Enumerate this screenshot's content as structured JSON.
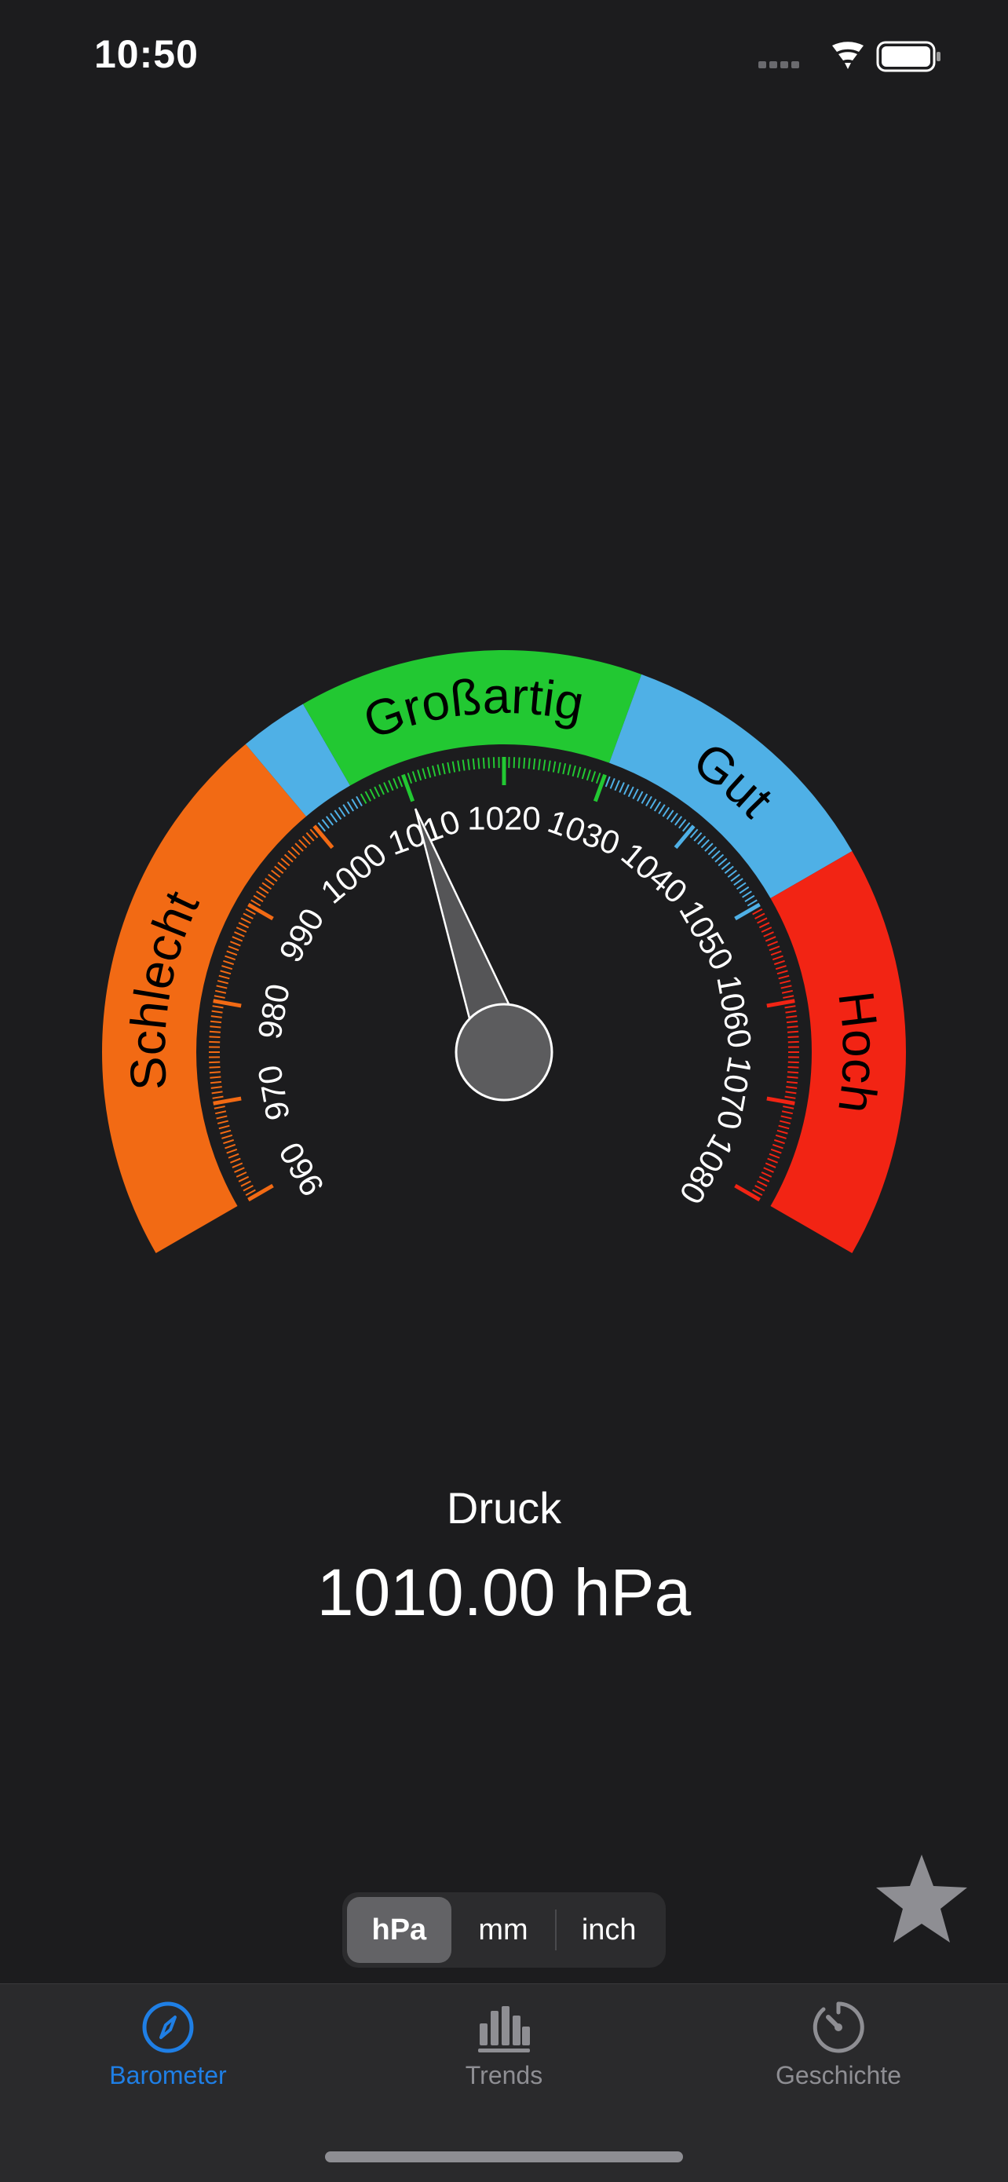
{
  "status": {
    "time": "10:50"
  },
  "gauge": {
    "unit": "hPa",
    "value": 1010,
    "min": 960,
    "max": 1080,
    "tick_labels": [
      "960",
      "970",
      "980",
      "990",
      "1000",
      "1010",
      "1020",
      "1030",
      "1040",
      "1050",
      "1060",
      "1070",
      "1080"
    ],
    "zones": [
      {
        "label": "Schlecht",
        "from": 960,
        "to": 1000,
        "color": "#f26a14"
      },
      {
        "label": "",
        "from": 1000,
        "to": 1005,
        "color": "#4fb0e6"
      },
      {
        "label": "Großartig",
        "from": 1005,
        "to": 1030,
        "color": "#22c832"
      },
      {
        "label": "Gut",
        "from": 1030,
        "to": 1050,
        "color": "#4fb0e6"
      },
      {
        "label": "Hoch",
        "from": 1050,
        "to": 1080,
        "color": "#f22414"
      }
    ]
  },
  "reading": {
    "label": "Druck",
    "value_text": "1010.00 hPa"
  },
  "units": {
    "options": [
      "hPa",
      "mm",
      "inch"
    ],
    "selected": "hPa"
  },
  "tabs": [
    {
      "label": "Barometer",
      "icon": "compass-icon",
      "active": true
    },
    {
      "label": "Trends",
      "icon": "bar-chart-icon",
      "active": false
    },
    {
      "label": "Geschichte",
      "icon": "timer-icon",
      "active": false
    }
  ],
  "colors": {
    "background": "#1c1c1e",
    "accent": "#1f7fe5",
    "inactive": "#8e8e93"
  },
  "favorite_icon": "star-icon"
}
